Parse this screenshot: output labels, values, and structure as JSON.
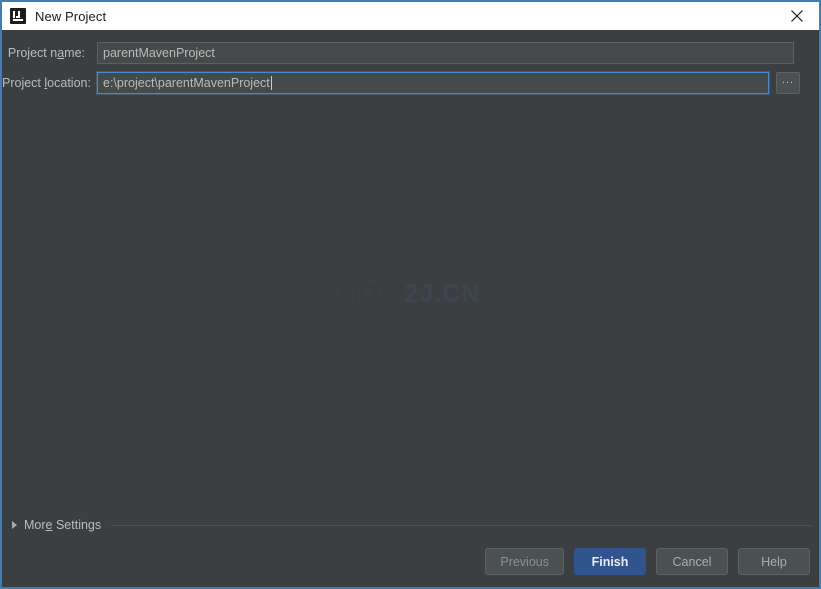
{
  "window": {
    "title": "New Project",
    "app_icon": "intellij-idea-icon",
    "close_icon": "close-icon",
    "border_color": "#3d7eb5",
    "titlebar_bg": "#ffffff",
    "body_bg": "#3c3f41"
  },
  "form": {
    "name_field": {
      "label_prefix": "Project n",
      "label_mnemonic": "a",
      "label_suffix": "me:",
      "value": "parentMavenProject",
      "placeholder": ""
    },
    "location_field": {
      "label_prefix": "Project ",
      "label_mnemonic": "l",
      "label_suffix": "ocation:",
      "value": "e:\\project\\parentMavenProject",
      "placeholder": "",
      "focused": true,
      "browse_label": "...",
      "browse_icon": "ellipsis-icon"
    }
  },
  "watermark": {
    "part1": "HOW",
    "part2": "2J.",
    "part3": "CN",
    "color1": "#3a3d40",
    "color2": "#3f4550"
  },
  "more_settings": {
    "prefix": "Mor",
    "mnemonic": "e",
    "suffix": " Settings",
    "expanded": false,
    "toggle_icon": "chevron-right-icon"
  },
  "buttons": [
    {
      "label": "Previous",
      "name": "previous-button",
      "style": "dim"
    },
    {
      "label": "Finish",
      "name": "finish-button",
      "style": "default"
    },
    {
      "label": "Cancel",
      "name": "cancel-button",
      "style": "normal"
    },
    {
      "label": "Help",
      "name": "help-button",
      "style": "normal"
    }
  ],
  "colors": {
    "accent": "#31538e",
    "focus_border": "#4a88c7",
    "field_bg": "#45494a",
    "text": "#bbbbbb"
  }
}
